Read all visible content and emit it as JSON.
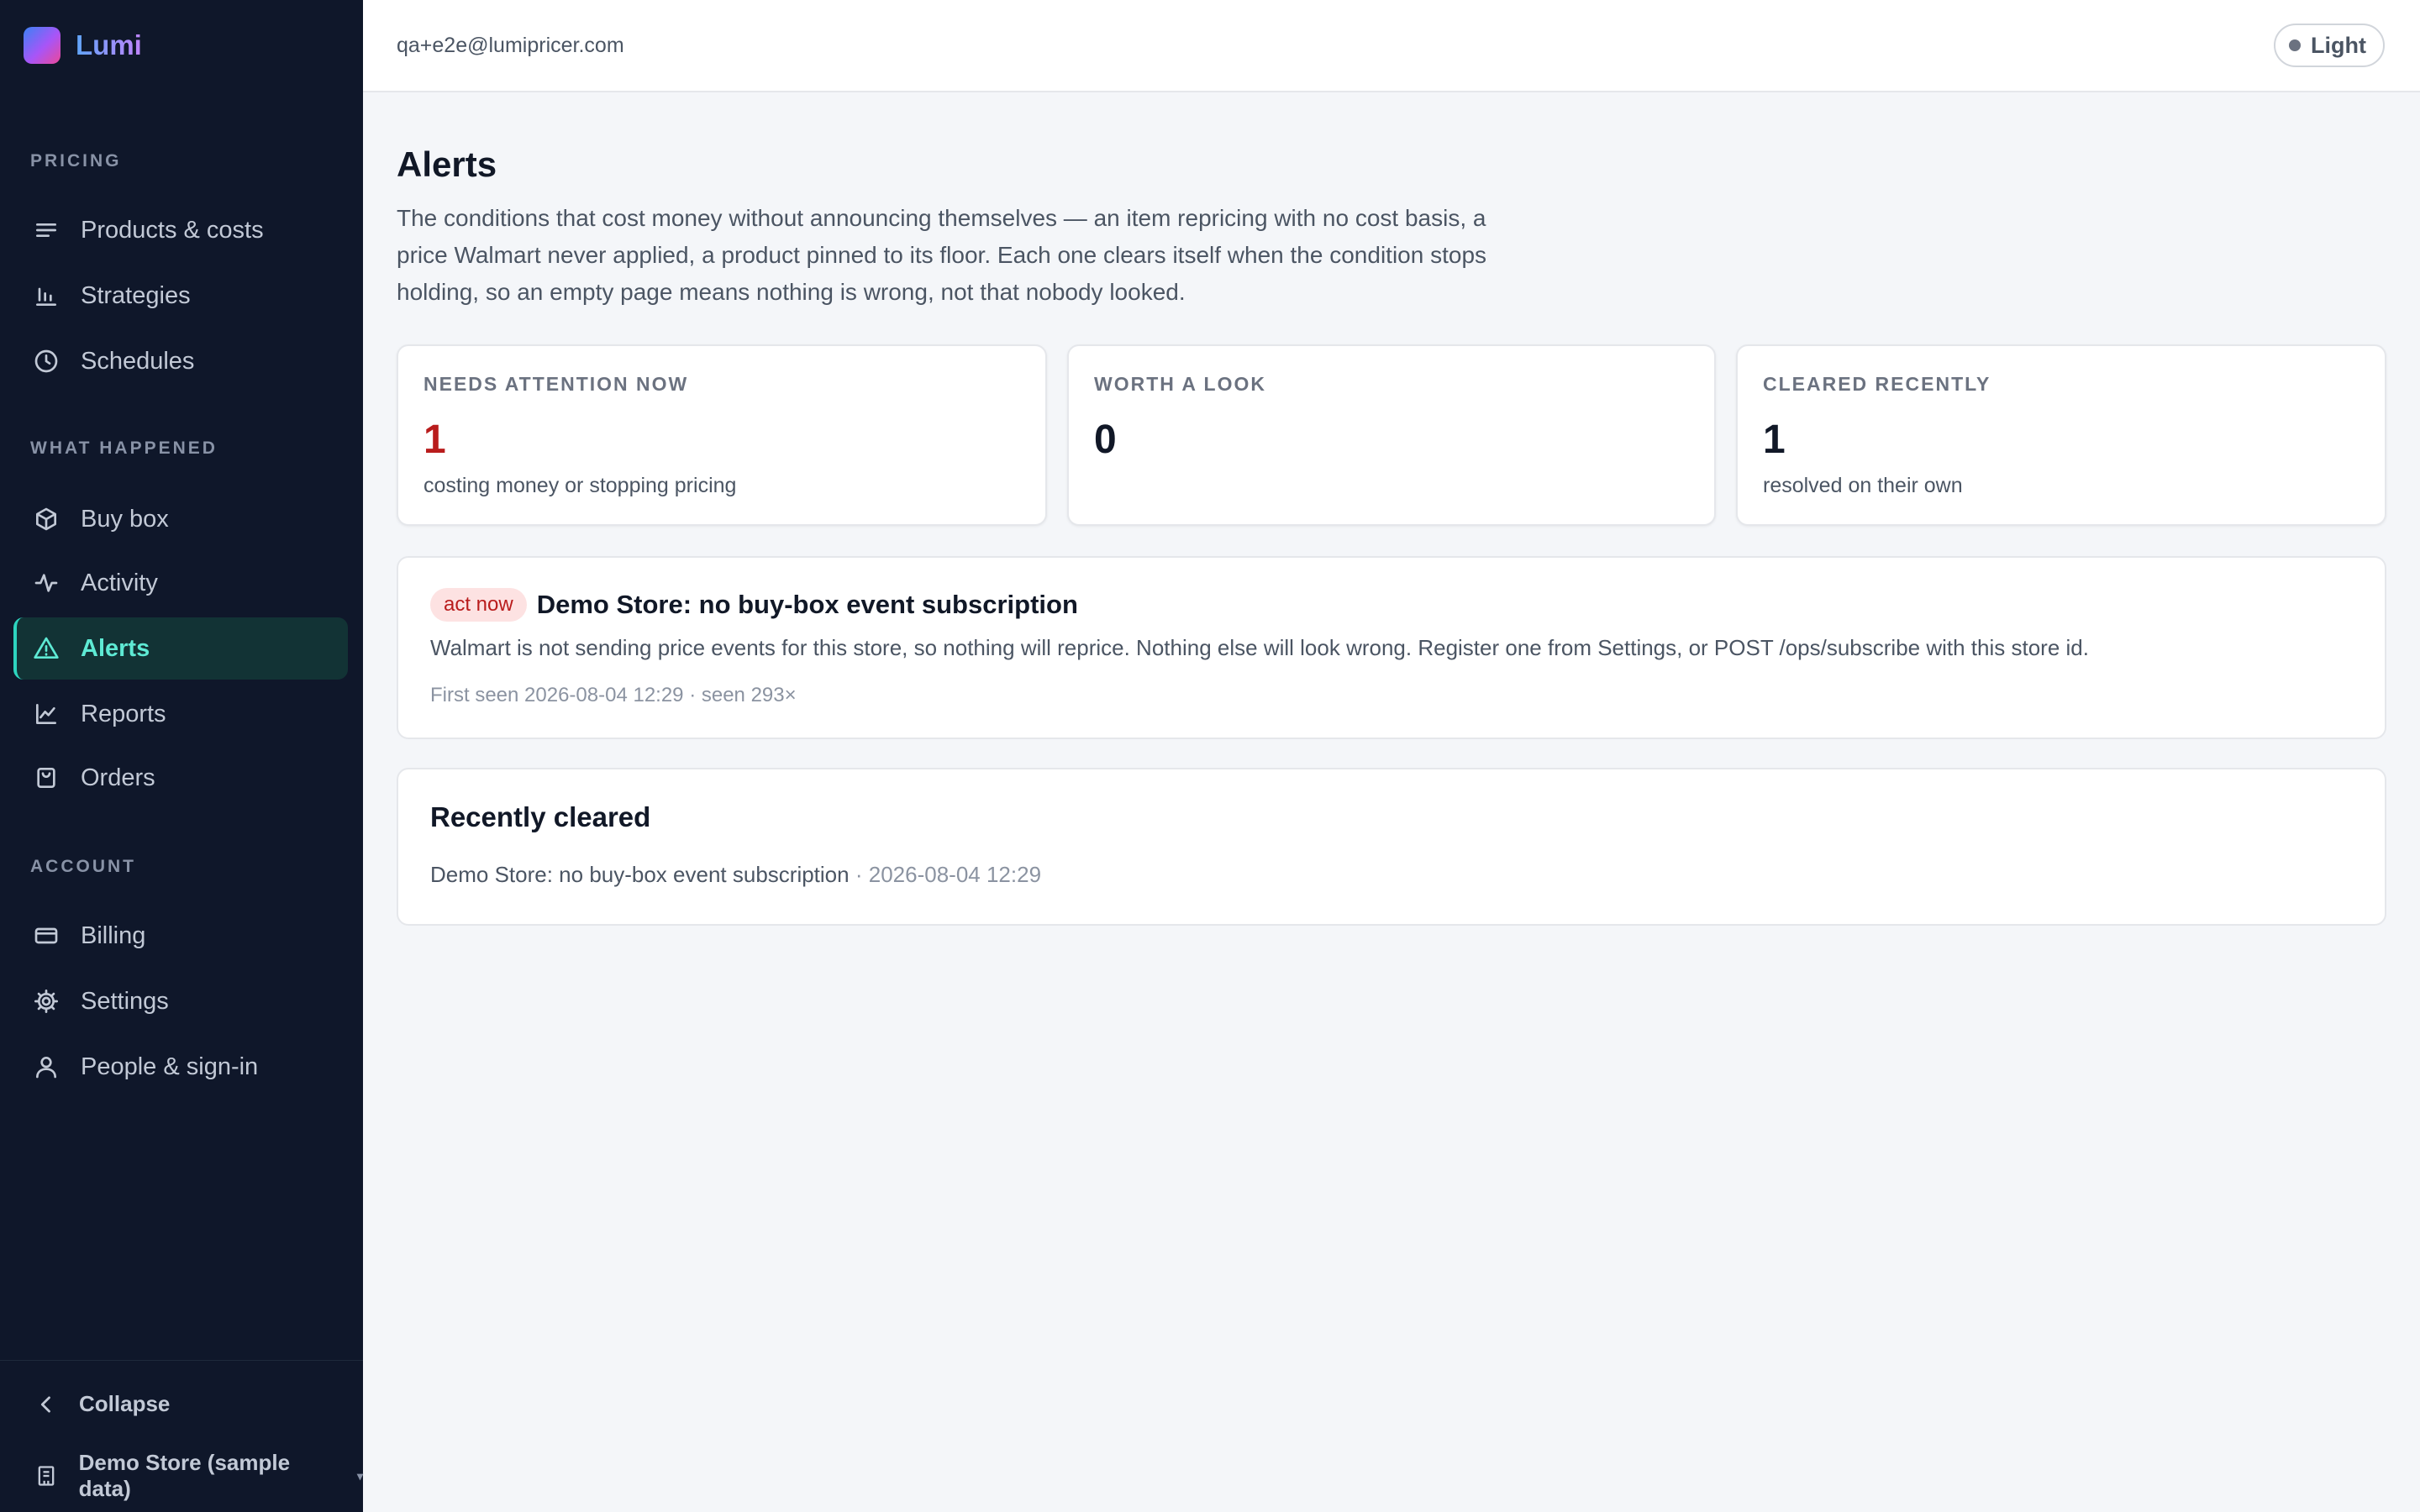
{
  "app": {
    "name": "Lumi"
  },
  "sidebar": {
    "sections": [
      {
        "label": "PRICING",
        "items": [
          {
            "label": "Products & costs",
            "icon": "list-icon"
          },
          {
            "label": "Strategies",
            "icon": "bar-chart-icon"
          },
          {
            "label": "Schedules",
            "icon": "clock-icon"
          }
        ]
      },
      {
        "label": "WHAT HAPPENED",
        "items": [
          {
            "label": "Buy box",
            "icon": "box-icon"
          },
          {
            "label": "Activity",
            "icon": "pulse-icon"
          },
          {
            "label": "Alerts",
            "icon": "warning-icon",
            "active": true
          },
          {
            "label": "Reports",
            "icon": "line-chart-icon"
          },
          {
            "label": "Orders",
            "icon": "shopping-bag-icon"
          }
        ]
      },
      {
        "label": "ACCOUNT",
        "items": [
          {
            "label": "Billing",
            "icon": "credit-card-icon"
          },
          {
            "label": "Settings",
            "icon": "gear-icon"
          },
          {
            "label": "People & sign-in",
            "icon": "user-icon"
          }
        ]
      }
    ],
    "footer": {
      "collapse_label": "Collapse",
      "store_label": "Demo Store (sample data)"
    }
  },
  "topbar": {
    "email": "qa+e2e@lumipricer.com",
    "theme_label": "Light"
  },
  "page": {
    "title": "Alerts",
    "description": "The conditions that cost money without announcing themselves — an item repricing with no cost basis, a price Walmart never applied, a product pinned to its floor. Each one clears itself when the condition stops holding, so an empty page means nothing is wrong, not that nobody looked."
  },
  "stats": [
    {
      "label": "NEEDS ATTENTION NOW",
      "value": "1",
      "sub": "costing money or stopping pricing",
      "color": "#b91c1c"
    },
    {
      "label": "WORTH A LOOK",
      "value": "0",
      "sub": ""
    },
    {
      "label": "CLEARED RECENTLY",
      "value": "1",
      "sub": "resolved on their own"
    }
  ],
  "alerts": [
    {
      "badge": "act now",
      "title": "Demo Store: no buy-box event subscription",
      "body": "Walmart is not sending price events for this store, so nothing will reprice. Nothing else will look wrong. Register one from Settings, or POST /ops/subscribe with this store id.",
      "meta": "First seen 2026-08-04 12:29 · seen 293×"
    }
  ],
  "cleared": {
    "title": "Recently cleared",
    "items": [
      {
        "text": "Demo Store: no buy-box event subscription",
        "separator": "·",
        "timestamp": "2026-08-04 12:29"
      }
    ]
  },
  "colors": {
    "sidebar_bg": "#0f172a",
    "accent": "#2dd4bf",
    "danger": "#b91c1c"
  }
}
